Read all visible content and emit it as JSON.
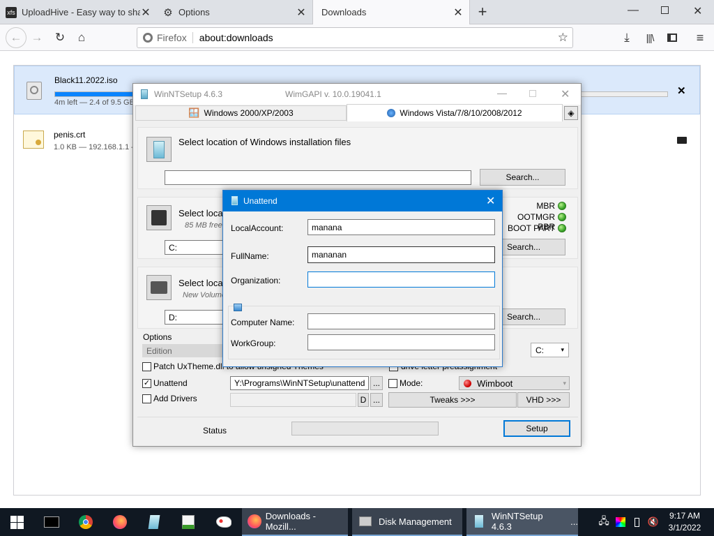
{
  "browser": {
    "tabs": [
      {
        "label": "UploadHive - Easy way to share",
        "favicon": "xfs"
      },
      {
        "label": "Options",
        "favicon": "gear-icon"
      },
      {
        "label": "Downloads",
        "favicon": ""
      }
    ],
    "url_identity": "Firefox",
    "url": "about:downloads"
  },
  "downloads": [
    {
      "name": "Black11.2022.iso",
      "status": "4m left — 2.4 of 9.5 GB",
      "progress": 0.25
    },
    {
      "name": "penis.crt",
      "status": "1.0 KB — 192.168.1.1 —"
    }
  ],
  "winnt": {
    "title": "WinNTSetup 4.6.3",
    "wimgapi": "WimGAPI v. 10.0.19041.1",
    "tab_xp": "Windows 2000/XP/2003",
    "tab_vista": "Windows Vista/7/8/10/2008/2012",
    "sec1_label": "Select location of Windows installation files",
    "search": "Search...",
    "sec2_label": "Select locat",
    "sec2_sub": "85 MB free",
    "sec2_drive": "C:",
    "mbr": "MBR",
    "bootmgr": "OOTMGR PBR",
    "bootpart": "BOOT PART",
    "sec3_label": "Select locat",
    "sec3_sub": "New Volume",
    "sec3_drive": "D:",
    "options": "Options",
    "edition": "Edition",
    "drive_sel": "C:",
    "patch": "Patch UxTheme.dll to allow unsigned Themes",
    "drive_letter": "drive letter preassignment",
    "unattend": "Unattend",
    "unattend_path": "Y:\\Programs\\WinNTSetup\\unattend",
    "mode": "Mode:",
    "wimboot": "Wimboot",
    "add_drivers": "Add Drivers",
    "drv_letter": "D",
    "dots": "...",
    "tweaks": "Tweaks >>>",
    "vhd": "VHD >>>",
    "status": "Status",
    "setup": "Setup"
  },
  "unattend_dlg": {
    "title": "Unattend",
    "local_label": "LocalAccount:",
    "local_value": "manana",
    "full_label": "FullName:",
    "full_value": "mananan",
    "org_label": "Organization:",
    "org_value": "",
    "comp_label": "Computer Name:",
    "comp_value": "",
    "wg_label": "WorkGroup:",
    "wg_value": ""
  },
  "taskbar": {
    "apps": [
      "Downloads - Mozill...",
      "Disk Management",
      "WinNTSetup 4.6.3"
    ],
    "ellipsis": "...",
    "time": "9:17 AM",
    "date": "3/1/2022"
  }
}
